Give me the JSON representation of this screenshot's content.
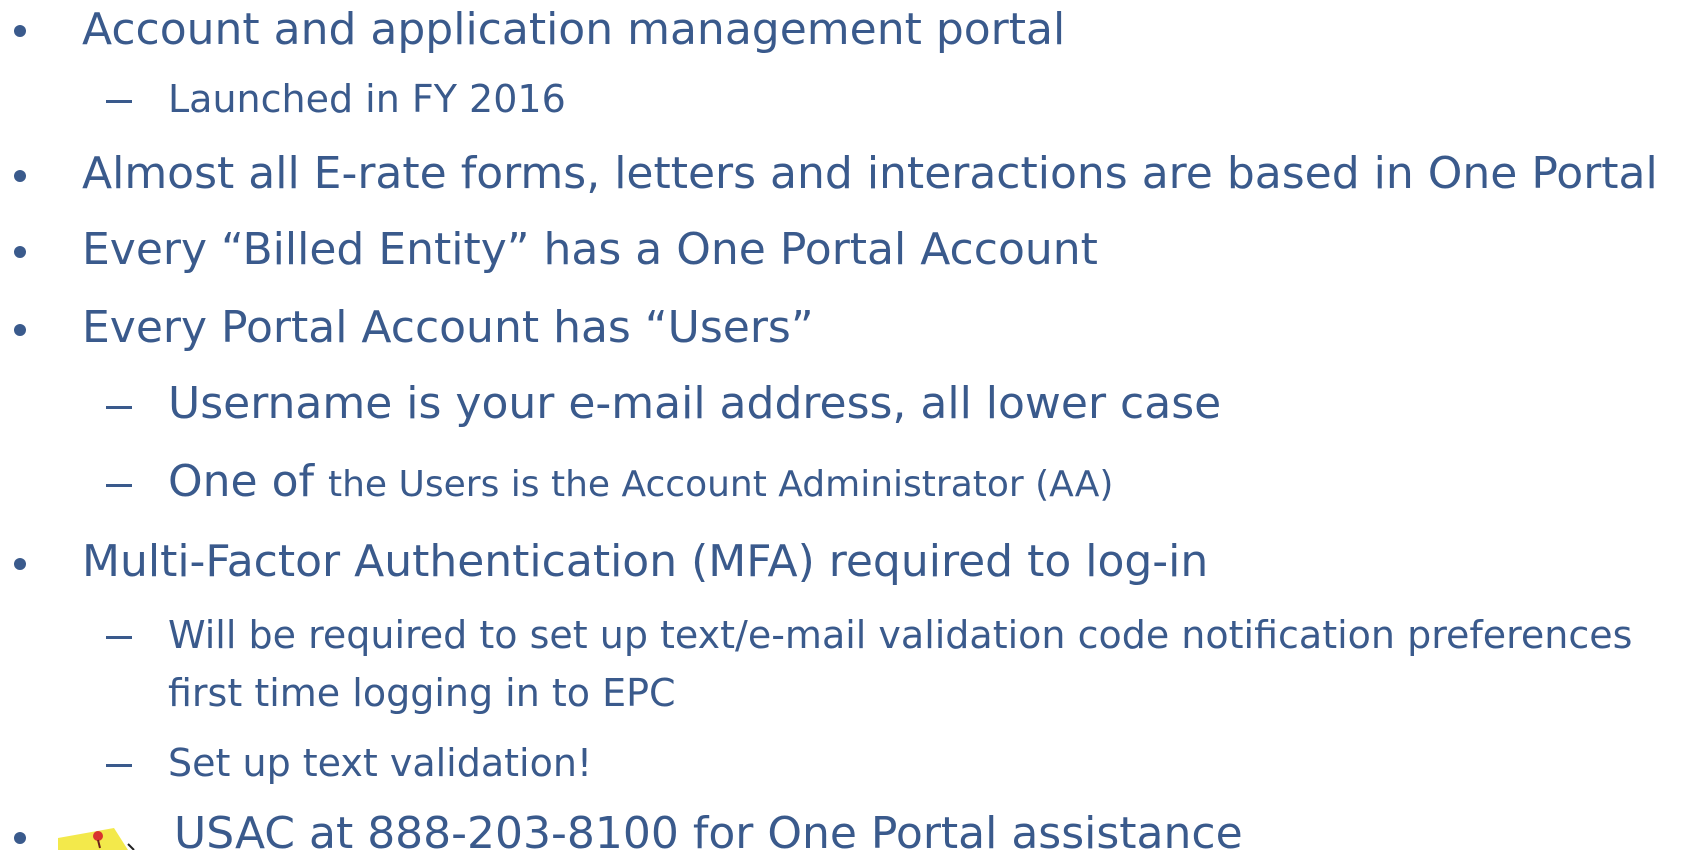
{
  "bullets": {
    "b1": "Account and application management portal",
    "b1_sub1": "Launched in FY 2016",
    "b2": "Almost all E-rate forms, letters and interactions are based in One Portal",
    "b3": "Every “Billed Entity” has a One Portal Account",
    "b4": "Every Portal Account has “Users”",
    "b4_sub1": "Username is your e-mail address, all lower case",
    "b4_sub2_lead": "One of ",
    "b4_sub2_rest": "the Users is the Account Administrator (AA)",
    "b5": "Multi-Factor Authentication (MFA) required to log-in",
    "b5_sub1_line1": "Will be required to set up text/e-mail validation code notification preferences",
    "b5_sub1_line2": "first time logging in to EPC",
    "b5_sub2": "Set up text validation!",
    "b6": "USAC at 888-203-8100 for One Portal assistance"
  },
  "icons": {
    "note": "sticky-note-pushpin-icon"
  },
  "colors": {
    "text": "#3a5a8c",
    "note_yellow": "#f3e94b",
    "pin_red": "#d8342f"
  }
}
